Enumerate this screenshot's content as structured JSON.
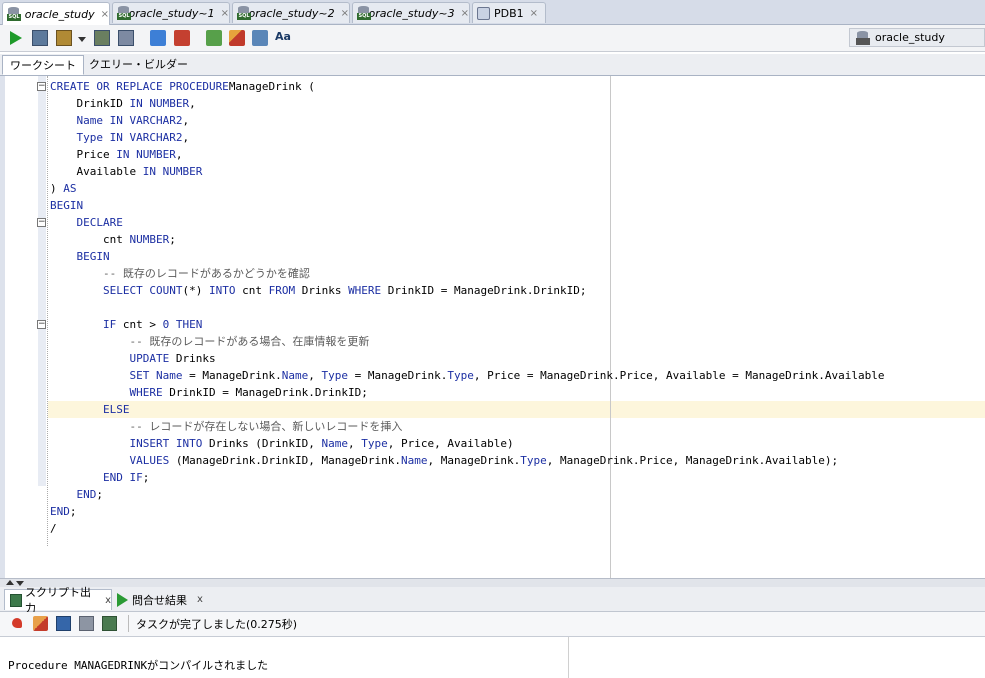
{
  "doc_tabs": [
    {
      "label": "oracle_study",
      "close": "×",
      "active": true
    },
    {
      "label": "oracle_study~1",
      "close": "×",
      "active": false
    },
    {
      "label": "oracle_study~2",
      "close": "×",
      "active": false
    },
    {
      "label": "oracle_study~3",
      "close": "×",
      "active": false
    },
    {
      "label": "PDB1",
      "close": "×",
      "active": false
    }
  ],
  "toolbar": {
    "connection": "oracle_study",
    "icons": [
      "run-statement-icon",
      "run-script-icon",
      "commit-icon",
      "dropdown-icon",
      "rollback-icon",
      "explain-plan-icon",
      "autotrace-icon",
      "sql-tuning-icon",
      "clear-icon",
      "history-icon",
      "format-icon"
    ],
    "format_text": "Aa"
  },
  "subtabs": {
    "worksheet": "ワークシート",
    "query_builder": "クエリー・ビルダー"
  },
  "editor": {
    "lines": [
      [
        [
          "k",
          "CREATE OR REPLACE PROCEDURE"
        ],
        [
          "",
          "ManageDrink ("
        ]
      ],
      [
        [
          "",
          "    DrinkID "
        ],
        [
          "k",
          "IN NUMBER"
        ],
        [
          "",
          ","
        ]
      ],
      [
        [
          "k",
          "    Name IN VARCHAR2"
        ],
        [
          "",
          ","
        ]
      ],
      [
        [
          "k",
          "    Type IN VARCHAR2"
        ],
        [
          "",
          ","
        ]
      ],
      [
        [
          "",
          "    Price "
        ],
        [
          "k",
          "IN NUMBER"
        ],
        [
          "",
          ","
        ]
      ],
      [
        [
          "",
          "    Available "
        ],
        [
          "k",
          "IN NUMBER"
        ]
      ],
      [
        [
          "",
          ") "
        ],
        [
          "k",
          "AS"
        ]
      ],
      [
        [
          "k",
          "BEGIN"
        ]
      ],
      [
        [
          "k",
          "    DECLARE"
        ]
      ],
      [
        [
          "",
          "        cnt "
        ],
        [
          "k",
          "NUMBER"
        ],
        [
          "",
          ";"
        ]
      ],
      [
        [
          "k",
          "    BEGIN"
        ]
      ],
      [
        [
          "c",
          "        -- 既存のレコードがあるかどうかを確認"
        ]
      ],
      [
        [
          "k",
          "        SELECT COUNT"
        ],
        [
          "",
          "(*) "
        ],
        [
          "k",
          "INTO"
        ],
        [
          "",
          " cnt "
        ],
        [
          "k",
          "FROM"
        ],
        [
          "",
          " Drinks "
        ],
        [
          "k",
          "WHERE"
        ],
        [
          "",
          " DrinkID = ManageDrink.DrinkID;"
        ]
      ],
      [
        [
          "",
          ""
        ]
      ],
      [
        [
          "k",
          "        IF"
        ],
        [
          "",
          " cnt > "
        ],
        [
          "k",
          "0 THEN"
        ]
      ],
      [
        [
          "c",
          "            -- 既存のレコードがある場合、在庫情報を更新"
        ]
      ],
      [
        [
          "k",
          "            UPDATE"
        ],
        [
          "",
          " Drinks"
        ]
      ],
      [
        [
          "k",
          "            SET Name"
        ],
        [
          "",
          " = ManageDrink."
        ],
        [
          "k",
          "Name"
        ],
        [
          "",
          ", "
        ],
        [
          "k",
          "Type"
        ],
        [
          "",
          " = ManageDrink."
        ],
        [
          "k",
          "Type"
        ],
        [
          "",
          ", Price = ManageDrink.Price, Available = ManageDrink.Available"
        ]
      ],
      [
        [
          "k",
          "            WHERE"
        ],
        [
          "",
          " DrinkID = ManageDrink.DrinkID;"
        ]
      ],
      [
        [
          "k",
          "        ELSE"
        ]
      ],
      [
        [
          "c",
          "            -- レコードが存在しない場合、新しいレコードを挿入"
        ]
      ],
      [
        [
          "k",
          "            INSERT INTO"
        ],
        [
          "",
          " Drinks (DrinkID, "
        ],
        [
          "k",
          "Name"
        ],
        [
          "",
          ", "
        ],
        [
          "k",
          "Type"
        ],
        [
          "",
          ", Price, Available)"
        ]
      ],
      [
        [
          "k",
          "            VALUES"
        ],
        [
          "",
          " (ManageDrink.DrinkID, ManageDrink."
        ],
        [
          "k",
          "Name"
        ],
        [
          "",
          ", ManageDrink."
        ],
        [
          "k",
          "Type"
        ],
        [
          "",
          ", ManageDrink.Price, ManageDrink.Available);"
        ]
      ],
      [
        [
          "k",
          "        END IF"
        ],
        [
          "",
          ";"
        ]
      ],
      [
        [
          "k",
          "    END"
        ],
        [
          "",
          ";"
        ]
      ],
      [
        [
          "k",
          "END"
        ],
        [
          "",
          ";"
        ]
      ],
      [
        [
          "",
          "/"
        ]
      ]
    ]
  },
  "bottom": {
    "tabs": [
      {
        "label": "スクリプト出力",
        "close": "x"
      },
      {
        "label": "問合せ結果",
        "close": "x"
      }
    ],
    "status": "タスクが完了しました(0.275秒)",
    "output": "Procedure MANAGEDRINKがコンパイルされました"
  },
  "colors": {
    "keyword": "#1c2fa3",
    "comment": "#5b5b5b",
    "current_line": "#fdf6dc"
  }
}
